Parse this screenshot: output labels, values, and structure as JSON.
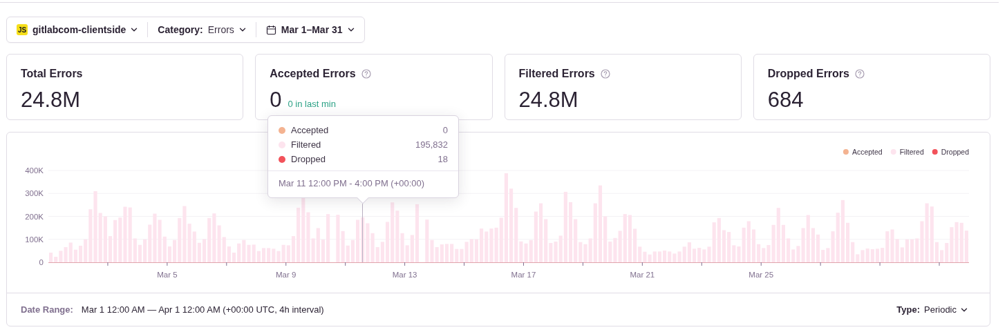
{
  "filter_bar": {
    "project": {
      "badge": "JS",
      "name": "gitlabcom-clientside"
    },
    "category": {
      "label": "Category:",
      "value": "Errors"
    },
    "date": {
      "value": "Mar 1–Mar 31"
    }
  },
  "cards": [
    {
      "title": "Total Errors",
      "value": "24.8M",
      "help": false
    },
    {
      "title": "Accepted Errors",
      "value": "0",
      "help": true,
      "note": "0 in last min"
    },
    {
      "title": "Filtered Errors",
      "value": "24.8M",
      "help": true
    },
    {
      "title": "Dropped Errors",
      "value": "684",
      "help": true
    }
  ],
  "chart": {
    "x_axis_labels": [
      "Mar 5",
      "Mar 9",
      "Mar 13",
      "Mar 17",
      "Mar 21",
      "Mar 25"
    ],
    "chart_data": {
      "type": "bar",
      "stacked": true,
      "grid": true,
      "ylim": [
        0,
        400
      ],
      "yticks": [
        {
          "value": 0,
          "label": "0"
        },
        {
          "value": 100,
          "label": "100K"
        },
        {
          "value": 200,
          "label": "200K"
        },
        {
          "value": 300,
          "label": "300K"
        },
        {
          "value": 400,
          "label": "400K"
        }
      ],
      "series": [
        {
          "name": "Accepted",
          "color": "#f4b391",
          "values": [
            0,
            0,
            0,
            0,
            0,
            0,
            0,
            0,
            0,
            0,
            0,
            0,
            0,
            0,
            0,
            0,
            0,
            0,
            0,
            0,
            0,
            0,
            0,
            0,
            0,
            0,
            0,
            0,
            0,
            0,
            0,
            0,
            0,
            0,
            0,
            0,
            0,
            0,
            0,
            0,
            0,
            0,
            0,
            0,
            0,
            0,
            0,
            0,
            0,
            0,
            0,
            0,
            0,
            0,
            0,
            0,
            0,
            0,
            0,
            0,
            0,
            0,
            0,
            0,
            0,
            0,
            0,
            0,
            0,
            0,
            0,
            0,
            0,
            0,
            0,
            0,
            0,
            0,
            0,
            0,
            0,
            0,
            0,
            0,
            0,
            0,
            0,
            0,
            0,
            0,
            0,
            0,
            0,
            0,
            0,
            0,
            0,
            0,
            0,
            0,
            0,
            0,
            0,
            0,
            0,
            0,
            0,
            0,
            0,
            0,
            0,
            0,
            0,
            0,
            0,
            0,
            0,
            0,
            0,
            0,
            0,
            0,
            0,
            0,
            0,
            0,
            0,
            0,
            0,
            0,
            0,
            0,
            0,
            0,
            0,
            0,
            0,
            0,
            0,
            0,
            0,
            0,
            0,
            0,
            0,
            0,
            0,
            0,
            0,
            0,
            0,
            0,
            0,
            0,
            0,
            0,
            0,
            0,
            0,
            0,
            0,
            0,
            0,
            0,
            0,
            0,
            0,
            0,
            0,
            0,
            0,
            0,
            0,
            0,
            0,
            0,
            0,
            0,
            0,
            0,
            0,
            0,
            0,
            0,
            0,
            0
          ]
        },
        {
          "name": "Filtered",
          "color": "#fde4ee",
          "values": [
            42,
            24,
            50,
            66,
            86,
            55,
            72,
            100,
            231,
            310,
            215,
            200,
            114,
            184,
            195,
            242,
            239,
            104,
            76,
            100,
            164,
            212,
            185,
            112,
            69,
            97,
            193,
            245,
            168,
            134,
            85,
            101,
            193,
            213,
            161,
            110,
            69,
            42,
            82,
            97,
            76,
            77,
            49,
            62,
            62,
            59,
            49,
            76,
            74,
            114,
            238,
            280,
            218,
            104,
            149,
            99,
            210,
            null,
            207,
            136,
            73,
            97,
            185,
            196,
            170,
            127,
            66,
            89,
            176,
            261,
            225,
            127,
            74,
            119,
            253,
            null,
            186,
            97,
            66,
            78,
            80,
            80,
            58,
            58,
            89,
            101,
            100,
            147,
            134,
            147,
            151,
            194,
            388,
            321,
            237,
            91,
            82,
            97,
            221,
            257,
            188,
            84,
            90,
            116,
            307,
            262,
            188,
            88,
            79,
            104,
            257,
            335,
            200,
            90,
            106,
            137,
            210,
            206,
            146,
            68,
            46,
            34,
            47,
            47,
            51,
            47,
            38,
            47,
            68,
            87,
            59,
            63,
            56,
            68,
            174,
            193,
            140,
            132,
            74,
            69,
            151,
            179,
            143,
            79,
            62,
            75,
            163,
            237,
            163,
            104,
            56,
            71,
            149,
            206,
            149,
            121,
            54,
            62,
            135,
            216,
            271,
            172,
            88,
            35,
            53,
            60,
            57,
            59,
            63,
            135,
            143,
            101,
            65,
            100,
            100,
            104,
            179,
            257,
            243,
            88,
            53,
            84,
            153,
            175,
            172,
            138
          ]
        },
        {
          "name": "Dropped",
          "color": "#f2525a",
          "values": [
            0,
            0,
            0,
            0,
            0,
            0,
            0,
            0,
            0,
            0,
            0,
            0,
            0,
            0,
            0,
            0,
            0,
            0,
            0,
            0,
            0,
            0,
            0,
            0,
            0,
            0,
            0,
            0,
            0,
            0,
            0,
            0,
            0,
            0,
            0,
            0,
            0,
            0,
            0,
            0,
            0,
            0,
            0,
            0,
            0,
            0,
            0,
            0,
            0,
            0,
            0,
            0,
            0,
            0,
            0,
            0,
            0,
            0,
            0,
            0,
            0,
            0,
            0,
            0,
            0,
            0,
            0,
            0,
            0,
            0,
            0,
            0,
            0,
            0,
            0,
            0,
            0,
            0,
            0,
            0,
            0,
            0,
            0,
            0,
            0,
            0,
            0,
            0,
            0,
            0,
            0,
            0,
            0,
            0,
            0,
            0,
            0,
            0,
            0,
            0,
            0,
            0,
            0,
            0,
            0,
            0,
            0,
            0,
            0,
            0,
            0,
            0,
            0,
            0,
            0,
            0,
            0,
            0,
            0,
            0,
            0,
            0,
            0,
            0,
            0,
            0,
            0,
            0,
            0,
            0,
            0,
            0,
            0,
            0,
            0,
            0,
            0,
            0,
            0,
            0,
            0,
            0,
            0,
            0,
            0,
            0,
            0,
            0,
            0,
            0,
            0,
            0,
            0,
            0,
            0,
            0,
            0,
            0,
            0,
            0,
            0,
            0,
            0,
            0,
            0,
            0,
            0,
            0,
            0,
            0,
            0,
            0,
            0,
            0,
            0,
            0,
            0,
            0,
            0,
            0,
            0,
            0,
            0,
            0,
            0,
            0
          ]
        }
      ]
    },
    "tooltip": {
      "rows": [
        {
          "name": "Accepted",
          "value": "0",
          "color": "#f4b391"
        },
        {
          "name": "Filtered",
          "value": "195,832",
          "color": "#fde4ee"
        },
        {
          "name": "Dropped",
          "value": "18",
          "color": "#f2525a"
        }
      ],
      "date": "Mar 11 12:00 PM - 4:00 PM (+00:00)"
    }
  },
  "footer": {
    "date_range_label": "Date Range:",
    "date_range": "Mar 1 12:00 AM — Apr 1 12:00 AM (+00:00 UTC, 4h interval)",
    "type_label": "Type:",
    "type_value": "Periodic"
  }
}
